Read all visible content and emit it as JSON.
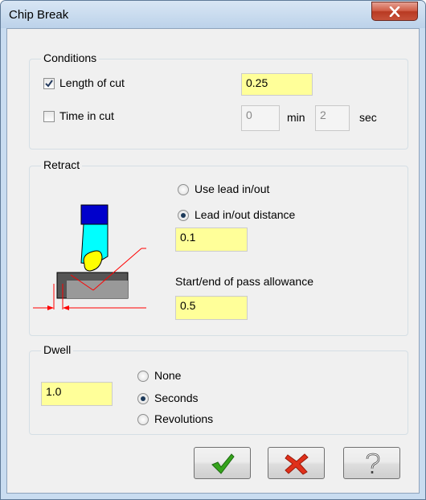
{
  "window": {
    "title": "Chip Break"
  },
  "conditions": {
    "label": "Conditions",
    "length_of_cut": {
      "label": "Length of cut",
      "checked": true,
      "value": "0.25"
    },
    "time_in_cut": {
      "label": "Time in cut",
      "checked": false,
      "min_value": "0",
      "min_label": "min",
      "sec_value": "2",
      "sec_label": "sec"
    }
  },
  "retract": {
    "label": "Retract",
    "use_lead": "Use lead in/out",
    "lead_distance": "Lead in/out distance",
    "lead_value": "0.1",
    "allowance_label": "Start/end of pass allowance",
    "allowance_value": "0.5",
    "selected": "Lead in/out distance"
  },
  "dwell": {
    "label": "Dwell",
    "value": "1.0",
    "options": [
      "None",
      "Seconds",
      "Revolutions"
    ],
    "selected": "Seconds"
  },
  "colors": {
    "input_bg": "#ffff99",
    "tool_blue": "#0000cc",
    "insert_yellow": "#ffff00",
    "holder_cyan": "#00ffff",
    "dimension_red": "#ff0000"
  }
}
